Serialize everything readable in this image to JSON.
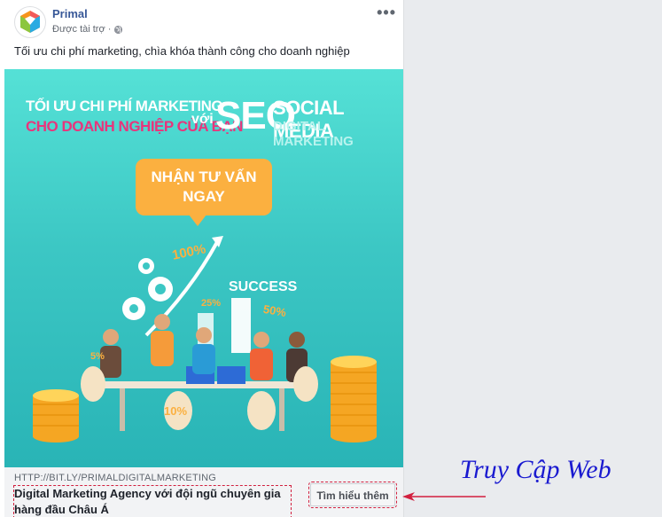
{
  "post": {
    "page_name": "Primal",
    "sponsored_label": "Được tài trợ",
    "separator": "·",
    "text": "Tối ưu chi phí marketing, chìa khóa thành công cho doanh nghiệp",
    "more_icon": "more-dots-icon",
    "globe_icon": "globe-icon"
  },
  "creative": {
    "headline_line1": "TỐI ƯU CHI PHÍ MARKETING",
    "headline_line2": "CHO DOANH NGHIỆP CỦA BẠN",
    "with_word": "với",
    "seo": "SEO",
    "social_media": "SOCIAL MEDIA",
    "digital_marketing": "DIGITAL MARKETING",
    "cta_line1": "NHẬN TƯ VẤN",
    "cta_line2": "NGAY",
    "label_100": "100%",
    "label_success": "SUCCESS",
    "label_50": "50%",
    "label_25": "25%",
    "label_5": "5%",
    "label_10": "10%",
    "colors": {
      "bg_top": "#55e1d6",
      "bg_bottom": "#29b4b6",
      "accent_orange": "#fbb040",
      "accent_pink": "#e8357c"
    }
  },
  "link": {
    "url": "HTTP://BIT.LY/PRIMALDIGITALMARKETING",
    "title": "Digital Marketing Agency với đội ngũ chuyên gia hàng đầu Châu Á",
    "button_label": "Tìm hiểu thêm"
  },
  "annotation": {
    "text": "Truy Cập Web",
    "color": "#1a1ad0",
    "arrow_color": "#d2203f"
  }
}
